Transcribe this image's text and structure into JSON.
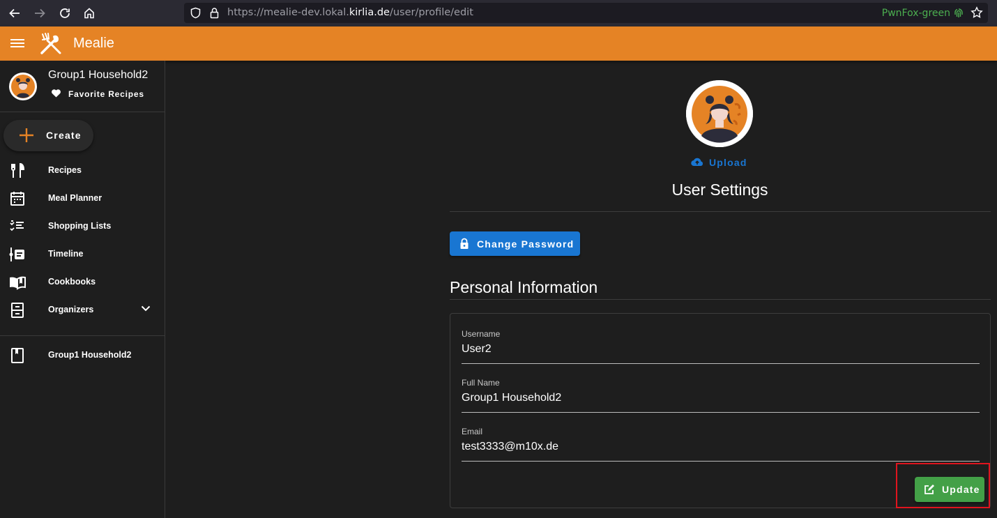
{
  "browser": {
    "url_prefix": "https://mealie-dev.lokal.",
    "url_domain": "kirlia.de",
    "url_path": "/user/profile/edit",
    "container_label": "PwnFox-green"
  },
  "app": {
    "title": "Mealie"
  },
  "sidebar": {
    "user_name": "Group1 Household2",
    "favorites_label": "Favorite Recipes",
    "create_label": "Create",
    "items": [
      {
        "label": "Recipes",
        "icon": "silverware-icon"
      },
      {
        "label": "Meal Planner",
        "icon": "calendar-icon"
      },
      {
        "label": "Shopping Lists",
        "icon": "checklist-icon"
      },
      {
        "label": "Timeline",
        "icon": "timeline-icon"
      },
      {
        "label": "Cookbooks",
        "icon": "book-open-icon"
      },
      {
        "label": "Organizers",
        "icon": "file-cabinet-icon"
      }
    ],
    "household_label": "Group1 Household2"
  },
  "main": {
    "upload_label": "Upload",
    "title": "User Settings",
    "change_password_label": "Change Password",
    "section_title": "Personal Information",
    "fields": [
      {
        "label": "Username",
        "value": "User2"
      },
      {
        "label": "Full Name",
        "value": "Group1 Household2"
      },
      {
        "label": "Email",
        "value": "test3333@m10x.de"
      }
    ],
    "update_label": "Update"
  },
  "colors": {
    "accent": "#e58325",
    "primary": "#1976d2",
    "success": "#43a047",
    "highlight": "#e0141e"
  }
}
